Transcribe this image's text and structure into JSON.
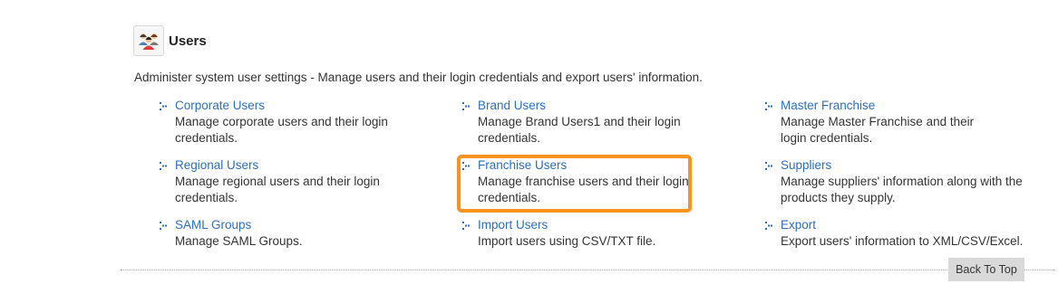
{
  "section": {
    "title": "Users",
    "icon": "users-group-icon",
    "description": "Administer system user settings - Manage users and their login credentials and export users' information."
  },
  "items": [
    {
      "label": "Corporate Users",
      "description": "Manage corporate users and their login credentials."
    },
    {
      "label": "Brand Users",
      "description": "Manage Brand Users1 and their login credentials."
    },
    {
      "label": "Master Franchise",
      "description": "Manage Master Franchise and their login credentials."
    },
    {
      "label": "Regional Users",
      "description": "Manage regional users and their login credentials."
    },
    {
      "label": "Franchise Users",
      "description": "Manage franchise users and their login credentials."
    },
    {
      "label": "Suppliers",
      "description": "Manage suppliers' information along with the products they supply."
    },
    {
      "label": "SAML Groups",
      "description": "Manage SAML Groups."
    },
    {
      "label": "Import Users",
      "description": "Import users using CSV/TXT file."
    },
    {
      "label": "Export",
      "description": "Export users' information to XML/CSV/Excel."
    }
  ],
  "highlight": {
    "color": "#f7931e"
  },
  "colors": {
    "link": "#2e6fb8",
    "text": "#333333"
  },
  "back_to_top": "Back To Top"
}
